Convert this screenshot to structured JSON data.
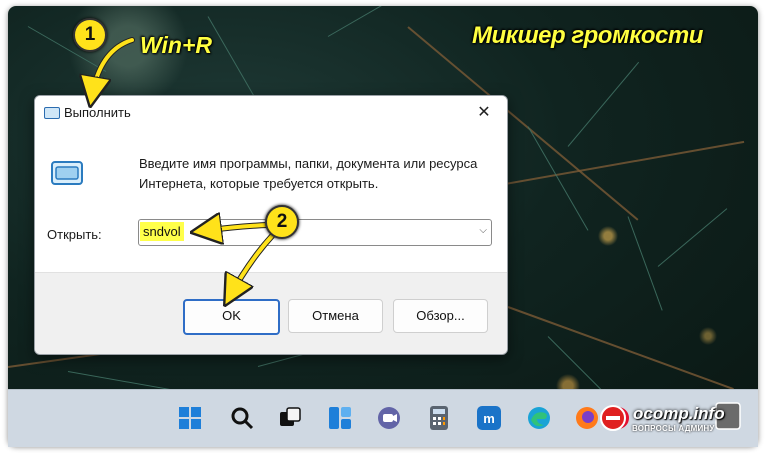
{
  "annotations": {
    "title": "Микшер громкости",
    "hotkey": "Win+R",
    "step1": "1",
    "step2": "2"
  },
  "dialog": {
    "title": "Выполнить",
    "close_glyph": "✕",
    "description": "Введите имя программы, папки, документа или ресурса Интернета, которые требуется открыть.",
    "open_label": "Открыть:",
    "open_value": "sndvol",
    "buttons": {
      "ok": "OK",
      "cancel": "Отмена",
      "browse": "Обзор..."
    }
  },
  "taskbar": {
    "icons": [
      "windows-start-icon",
      "search-icon",
      "task-view-icon",
      "widgets-icon",
      "teams-chat-icon",
      "calculator-icon",
      "maxthon-icon",
      "edge-icon",
      "firefox-icon",
      "opera-icon"
    ]
  },
  "watermark": {
    "text": "ocomp.info",
    "subtext": "ВОПРОСЫ АДМИНУ"
  },
  "colors": {
    "highlight": "#ffff4a",
    "annotation": "#ffe21a",
    "accent": "#2f6dc6"
  }
}
